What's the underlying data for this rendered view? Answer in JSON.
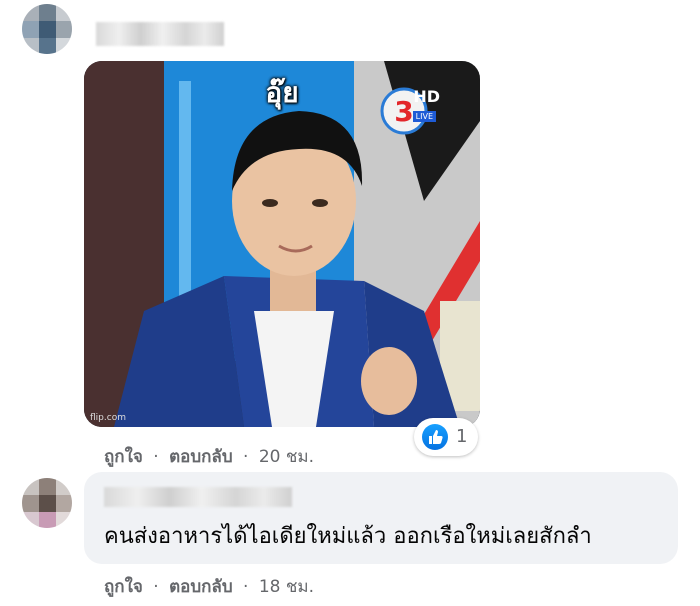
{
  "comment1": {
    "media": {
      "caption": "อุ๊ย",
      "channel_badge": "HD",
      "live_label": "LIVE",
      "watermark": "flip.com"
    },
    "reaction_count": "1",
    "actions": {
      "like_label": "ถูกใจ",
      "reply_label": "ตอบกลับ",
      "separator": "·",
      "timestamp": "20 ชม."
    }
  },
  "comment2": {
    "text": "คนส่งอาหารได้ไอเดียใหม่แล้ว ออกเรือใหม่เลยสักลำ",
    "actions": {
      "like_label": "ถูกใจ",
      "reply_label": "ตอบกลับ",
      "separator": "·",
      "timestamp": "18 ชม."
    }
  },
  "colors": {
    "bubble": "#f0f2f5",
    "meta_text": "#65676b",
    "like_blue": "#1877f2"
  },
  "icons": [
    "avatar-pixelated",
    "like-reaction-icon",
    "channel-3-logo"
  ]
}
